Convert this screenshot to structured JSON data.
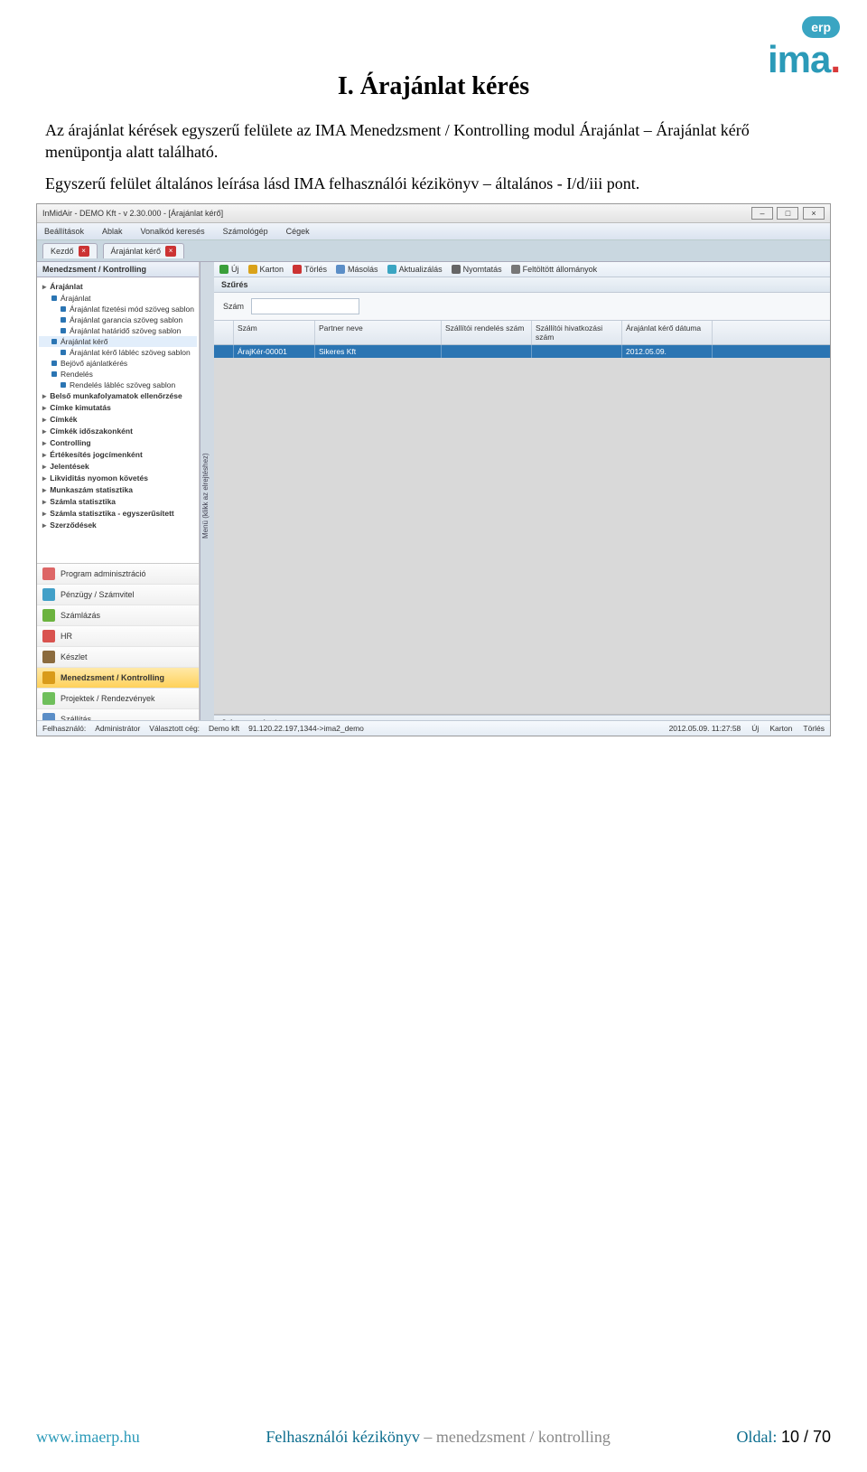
{
  "logo": {
    "cloud": "erp",
    "text_main": "ima",
    "text_suffix": "."
  },
  "title": "I. Árajánlat kérés",
  "para1": "Az árajánlat kérések egyszerű felülete az IMA Menedzsment / Kontrolling modul Árajánlat – Árajánlat kérő menüpontja alatt található.",
  "para2": "Egyszerű felület általános leírása lásd IMA felhasználói kézikönyv – általános - I/d/iii pont.",
  "ss": {
    "title": "InMidAir - DEMO Kft - v 2.30.000 - [Árajánlat kérő]",
    "menu": [
      "Beállítások",
      "Ablak",
      "Vonalkód keresés",
      "Számológép",
      "Cégek"
    ],
    "tabs": [
      {
        "label": "Kezdő"
      },
      {
        "label": "Árajánlat kérő"
      }
    ],
    "side_head": "Menedzsment / Kontrolling",
    "tree": [
      {
        "lvl": "root",
        "label": "Árajánlat"
      },
      {
        "lvl": "lvl1",
        "label": "Árajánlat"
      },
      {
        "lvl": "lvl2",
        "label": "Árajánlat fizetési mód szöveg sablon"
      },
      {
        "lvl": "lvl2",
        "label": "Árajánlat garancia szöveg sablon"
      },
      {
        "lvl": "lvl2",
        "label": "Árajánlat határidő szöveg sablon"
      },
      {
        "lvl": "lvl1",
        "label": "Árajánlat kérő",
        "sel": true
      },
      {
        "lvl": "lvl2",
        "label": "Árajánlat kérő lábléc szöveg sablon"
      },
      {
        "lvl": "lvl1",
        "label": "Bejövő ajánlatkérés"
      },
      {
        "lvl": "lvl1",
        "label": "Rendelés"
      },
      {
        "lvl": "lvl2",
        "label": "Rendelés lábléc szöveg sablon"
      },
      {
        "lvl": "root",
        "label": "Belső munkafolyamatok ellenőrzése"
      },
      {
        "lvl": "root",
        "label": "Címke kimutatás"
      },
      {
        "lvl": "root",
        "label": "Címkék"
      },
      {
        "lvl": "root",
        "label": "Címkék időszakonként"
      },
      {
        "lvl": "root",
        "label": "Controlling"
      },
      {
        "lvl": "root",
        "label": "Értékesítés jogcímenként"
      },
      {
        "lvl": "root",
        "label": "Jelentések"
      },
      {
        "lvl": "root",
        "label": "Likviditás nyomon követés"
      },
      {
        "lvl": "root",
        "label": "Munkaszám statisztika"
      },
      {
        "lvl": "root",
        "label": "Számla statisztika"
      },
      {
        "lvl": "root",
        "label": "Számla statisztika - egyszerűsített"
      },
      {
        "lvl": "root",
        "label": "Szerződések"
      }
    ],
    "modules": [
      {
        "label": "Program adminisztráció",
        "color": "#d66"
      },
      {
        "label": "Pénzügy / Számvitel",
        "color": "#42a0c8"
      },
      {
        "label": "Számlázás",
        "color": "#6cb33f"
      },
      {
        "label": "HR",
        "color": "#d9534f"
      },
      {
        "label": "Készlet",
        "color": "#8b6b3e"
      },
      {
        "label": "Menedzsment / Kontrolling",
        "color": "#d99b1a",
        "sel": true
      },
      {
        "label": "Projektek / Rendezvények",
        "color": "#6fbf5b"
      },
      {
        "label": "Szállítás",
        "color": "#5b8ec7"
      }
    ],
    "vtab": "Menü (klikk az elrejtéshez)",
    "toolbar": [
      {
        "label": "Új",
        "color": "#3a9f3a"
      },
      {
        "label": "Karton",
        "color": "#d9a21a"
      },
      {
        "label": "Törlés",
        "color": "#c33"
      },
      {
        "label": "Másolás",
        "color": "#5b8ec7"
      },
      {
        "label": "Aktualizálás",
        "color": "#3aa5c2"
      },
      {
        "label": "Nyomtatás",
        "color": "#666"
      },
      {
        "label": "Feltöltött állományok",
        "color": "#777"
      }
    ],
    "filter_head": "Szűrés",
    "filter_label": "Szám",
    "grid_head": [
      "",
      "Szám",
      "Partner neve",
      "Szállítói rendelés szám",
      "Szállítói hivatkozási szám",
      "Árajánlat kérő dátuma"
    ],
    "grid_row": [
      "",
      "ÁrajKér-00001",
      "Sikeres Kft",
      "",
      "",
      "2012.05.09."
    ],
    "jelm": "Jelmagyarázat",
    "status": {
      "user_label": "Felhasználó:",
      "user": "Administrátor",
      "ceg_label": "Választott cég:",
      "ceg": "Demo kft",
      "conn": "91.120.22.197,1344->ima2_demo",
      "time": "2012.05.09. 11:27:58",
      "btns": [
        "Új",
        "Karton",
        "Törlés"
      ]
    }
  },
  "footer": {
    "left": "www.imaerp.hu",
    "center_a": "Felhasználói kézikönyv",
    "center_b": "– menedzsment / kontrolling",
    "page_label": "Oldal:",
    "page": "10 / 70"
  }
}
